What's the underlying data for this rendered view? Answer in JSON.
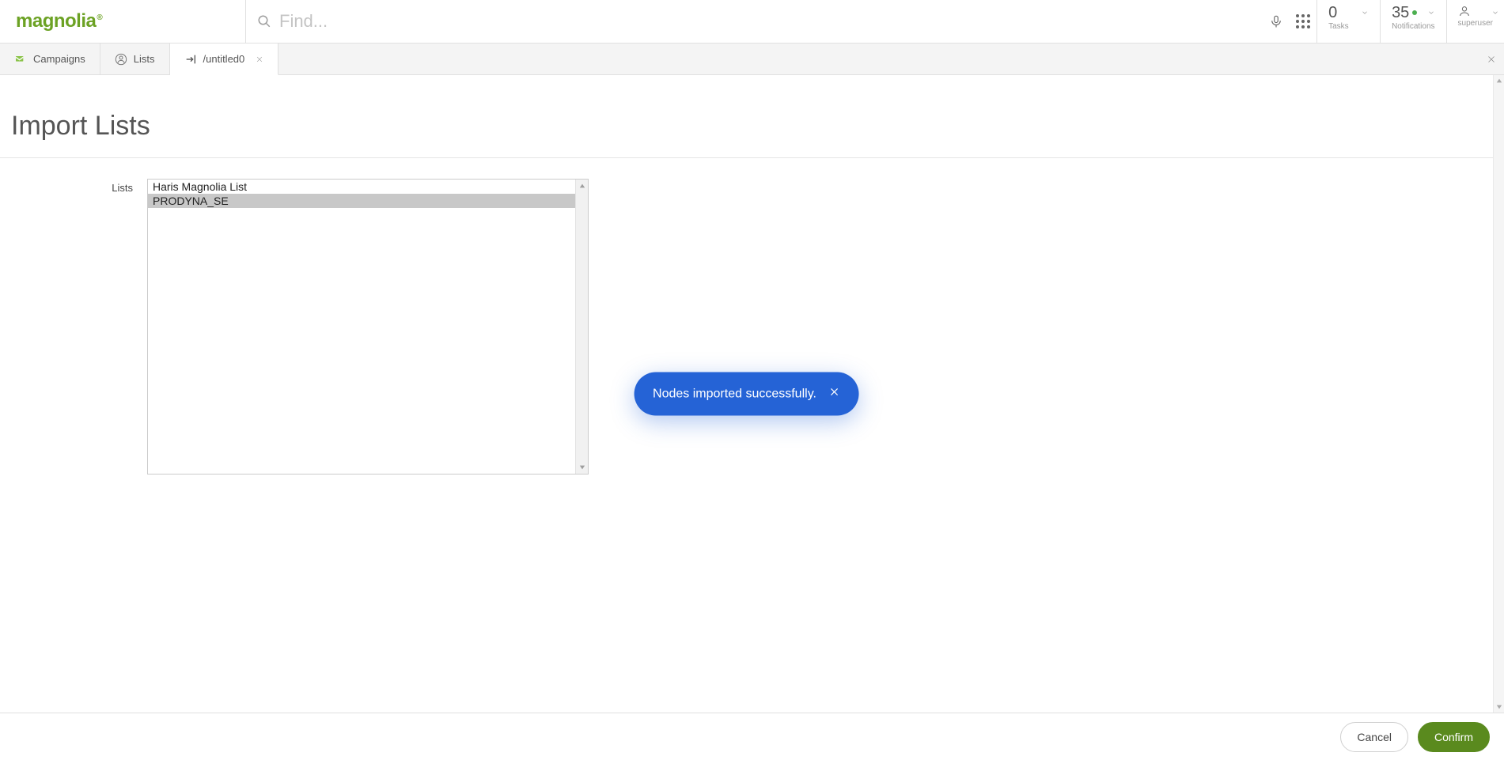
{
  "brand": "magnolia",
  "search": {
    "placeholder": "Find..."
  },
  "header_metrics": {
    "tasks": {
      "value": "0",
      "label": "Tasks"
    },
    "notifications": {
      "value": "35",
      "label": "Notifications"
    }
  },
  "user": {
    "name": "superuser"
  },
  "tabs": [
    {
      "label": "Campaigns",
      "icon": "campaign-icon",
      "active": false,
      "closable": false
    },
    {
      "label": "Lists",
      "icon": "contact-icon",
      "active": false,
      "closable": false
    },
    {
      "label": "/untitled0",
      "icon": "import-icon",
      "active": true,
      "closable": true
    }
  ],
  "page": {
    "title": "Import Lists",
    "form_label": "Lists",
    "list_items": [
      {
        "label": "Haris Magnolia List",
        "selected": false
      },
      {
        "label": "PRODYNA_SE",
        "selected": true
      }
    ]
  },
  "toast": {
    "message": "Nodes imported successfully."
  },
  "footer": {
    "cancel": "Cancel",
    "confirm": "Confirm"
  }
}
